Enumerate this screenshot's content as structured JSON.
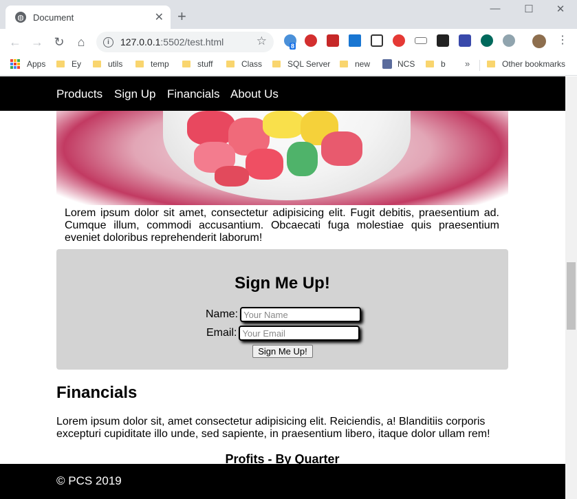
{
  "browser": {
    "tab_title": "Document",
    "url_host": "127.0.0.1",
    "url_path": ":5502/test.html",
    "extension_badge": "8",
    "bookmarks": [
      "Apps",
      "Ey",
      "utils",
      "temp",
      "stuff",
      "Class",
      "SQL Server",
      "new",
      "NCS",
      "b"
    ],
    "more_bookmarks": "»",
    "other_bookmarks": "Other bookmarks"
  },
  "nav": {
    "items": [
      "Products",
      "Sign Up",
      "Financials",
      "About Us"
    ]
  },
  "intro": {
    "text": "Lorem ipsum dolor sit amet, consectetur adipisicing elit. Fugit debitis, praesentium ad. Cumque illum, commodi accusantium. Obcaecati fuga molestiae quis praesentium eveniet doloribus reprehenderit laborum!"
  },
  "signup": {
    "heading": "Sign Me Up!",
    "name_label": "Name:",
    "name_placeholder": "Your Name",
    "email_label": "Email:",
    "email_placeholder": "Your Email",
    "button_label": "Sign Me Up!"
  },
  "financials": {
    "heading": "Financials",
    "text": "Lorem ipsum dolor sit, amet consectetur adipisicing elit. Reiciendis, a! Blanditiis corporis excepturi cupiditate illo unde, sed sapiente, in praesentium libero, itaque dolor ullam rem!",
    "chart_title": "Profits - By Quarter"
  },
  "footer": {
    "text": "© PCS 2019"
  }
}
